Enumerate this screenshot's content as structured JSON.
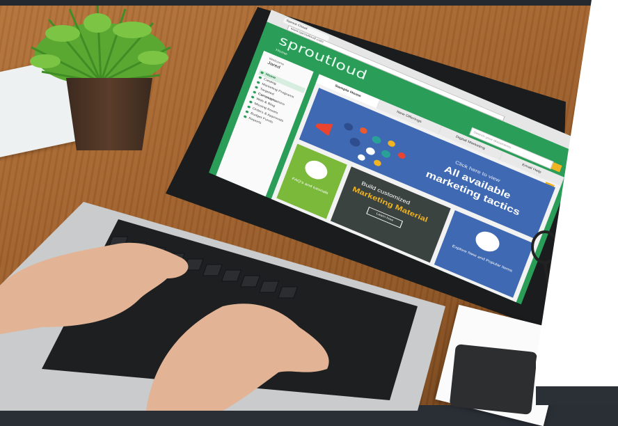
{
  "browser": {
    "tab_title": "Sprout Cloud",
    "url": "www.sproutloud.com"
  },
  "app": {
    "logo": "sproutloud",
    "home_label": "Home",
    "search_placeholder": "Search your documents"
  },
  "sidebar": {
    "welcome": "Welcome",
    "user": "Jared",
    "items": [
      {
        "label": "Home",
        "active": true
      },
      {
        "label": "Catalog"
      },
      {
        "label": "Marketing Programs"
      },
      {
        "label": "Targeted Communications"
      },
      {
        "label": "Campaigns"
      },
      {
        "label": "Web & Blog"
      },
      {
        "label": "Missing Assets"
      },
      {
        "label": "Orders & Approvals"
      },
      {
        "label": "Budget Funds"
      },
      {
        "label": "Reports"
      }
    ]
  },
  "tabs": [
    "Sample Home",
    "New Offerings",
    "Digital Marketing",
    "Email Help"
  ],
  "hero": {
    "line1": "Click here to view",
    "line2": "All available",
    "line3": "marketing tactics"
  },
  "tiles": {
    "faq": "FAQ's and tutorials",
    "build_line1": "Build customized",
    "build_line2": "Marketing Material",
    "build_button": "Learn how",
    "explore": "Explore New and Popular Items"
  },
  "colors": {
    "brand_green": "#2a9d58",
    "hero_blue": "#3f69b3",
    "accent_yellow": "#f0b323",
    "tile_green": "#7ab93a"
  }
}
